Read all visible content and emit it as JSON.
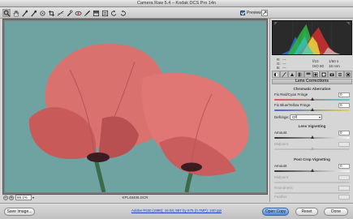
{
  "window": {
    "title": "Camera Raw 5.4  –  Kodak DCS Pro 14n"
  },
  "toolbar": {
    "tools": [
      "zoom-icon",
      "hand-icon",
      "white-balance-icon",
      "color-sampler-icon",
      "target-adjustment-icon",
      "crop-icon",
      "straighten-icon",
      "spot-removal-icon",
      "red-eye-icon",
      "adjustment-brush-icon",
      "graduated-filter-icon",
      "preferences-icon",
      "rotate-ccw-icon",
      "rotate-cw-icon"
    ],
    "preview_label": "Preview",
    "preview_checked": true
  },
  "image": {
    "filename": "KPL48406.DCR",
    "zoom_value": "88.1%",
    "sky_color": "#6fa3a1",
    "petal_color": "#d96a6a"
  },
  "histogram": {
    "readout": {
      "r_label": "R:",
      "r_value": "---",
      "g_label": "G:",
      "g_value": "---",
      "b_label": "B:",
      "b_value": "---",
      "aperture": "f/10",
      "shutter": "1/60 s",
      "iso": "ISO 80",
      "focal": "18 mm"
    }
  },
  "panel": {
    "tabs": [
      "basic-icon",
      "tone-curve-icon",
      "detail-icon",
      "hsl-icon",
      "split-toning-icon",
      "lens-corrections-icon",
      "effects-icon",
      "camera-calibration-icon",
      "presets-icon",
      "snapshots-icon"
    ],
    "active_tab_index": 5,
    "title": "Lens Corrections",
    "chromatic": {
      "title": "Chromatic Aberration",
      "red_cyan_label": "Fix Red/Cyan Fringe",
      "red_cyan_value": "0",
      "red_cyan_level": 0.5,
      "blue_yellow_label": "Fix Blue/Yellow Fringe",
      "blue_yellow_value": "0",
      "blue_yellow_level": 0.5,
      "defringe_label": "Defringe:",
      "defringe_value": "Off"
    },
    "vignetting": {
      "title": "Lens Vignetting",
      "amount_label": "Amount",
      "amount_value": "0",
      "amount_level": 0.5,
      "midpoint_label": "Midpoint",
      "midpoint_level": 0.5
    },
    "post_crop": {
      "title": "Post Crop Vignetting",
      "amount_label": "Amount",
      "amount_value": "0",
      "amount_level": 0.5,
      "midpoint_label": "Midpoint",
      "roundness_label": "Roundness",
      "feather_label": "Feather"
    }
  },
  "bottom": {
    "save_label": "Save Image...",
    "workflow_label": "Adobe RGB (1998); 16 bit; 987 by 675 (0.7MP); 240 ppi",
    "open_label": "Open Copy",
    "reset_label": "Reset",
    "done_label": "Done"
  }
}
